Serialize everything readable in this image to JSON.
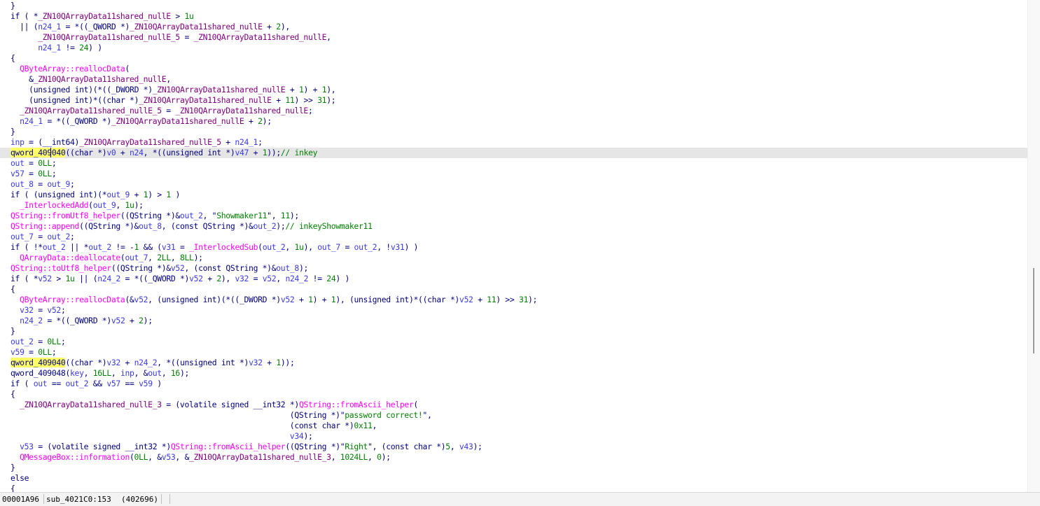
{
  "code_lines": [
    "}",
    "if ( *_ZN10QArrayData11shared_nullE > 1u",
    "  || (n24_1 = *((_QWORD *)_ZN10QArrayData11shared_nullE + 2),",
    "      _ZN10QArrayData11shared_nullE_5 = _ZN10QArrayData11shared_nullE,",
    "      n24_1 != 24) )",
    "{",
    "  QByteArray::reallocData(",
    "    &_ZN10QArrayData11shared_nullE,",
    "    (unsigned int)(*((_DWORD *)_ZN10QArrayData11shared_nullE + 1) + 1),",
    "    (unsigned int)*((char *)_ZN10QArrayData11shared_nullE + 11) >> 31);",
    "  _ZN10QArrayData11shared_nullE_5 = _ZN10QArrayData11shared_nullE;",
    "  n24_1 = *((_QWORD *)_ZN10QArrayData11shared_nullE + 2);",
    "}",
    "inp = (__int64)_ZN10QArrayData11shared_nullE_5 + n24_1;",
    "qword_409040((char *)v0 + n24, *((unsigned int *)v47 + 1));// inkey",
    "out = 0LL;",
    "v57 = 0LL;",
    "out_8 = out_9;",
    "if ( (unsigned int)(*out_9 + 1) > 1 )",
    "  _InterlockedAdd(out_9, 1u);",
    "QString::fromUtf8_helper((QString *)&out_2, \"Showmaker11\", 11);",
    "QString::append((QString *)&out_8, (const QString *)&out_2);// inkeyShowmaker11",
    "out_7 = out_2;",
    "if ( !*out_2 || *out_2 != -1 && (v31 = _InterlockedSub(out_2, 1u), out_7 = out_2, !v31) )",
    "  QArrayData::deallocate(out_7, 2LL, 8LL);",
    "QString::toUtf8_helper((QString *)&v52, (const QString *)&out_8);",
    "if ( *v52 > 1u || (n24_2 = *((_QWORD *)v52 + 2), v32 = v52, n24_2 != 24) )",
    "{",
    "  QByteArray::reallocData(&v52, (unsigned int)(*((_DWORD *)v52 + 1) + 1), (unsigned int)*((char *)v52 + 11) >> 31);",
    "  v32 = v52;",
    "  n24_2 = *((_QWORD *)v52 + 2);",
    "}",
    "out_2 = 0LL;",
    "v59 = 0LL;",
    "qword_409040((char *)v32 + n24_2, *((unsigned int *)v32 + 1));",
    "qword_409048(key, 16LL, inp, &out, 16);",
    "if ( out == out_2 && v57 == v59 )",
    "{",
    "  _ZN10QArrayData11shared_nullE_3 = (volatile signed __int32 *)QString::fromAscii_helper(",
    "                                                             (QString *)\"password correct!\",",
    "                                                             (const char *)0x11,",
    "                                                             v34);",
    "  v53 = (volatile signed __int32 *)QString::fromAscii_helper((QString *)\"Right\", (const char *)5, v43);",
    "  QMessageBox::information(0LL, &v53, &_ZN10QArrayData11shared_nullE_3, 1024LL, 0);",
    "}",
    "else",
    "{"
  ],
  "highlighted_line_index": 14,
  "highlight_word": "qword_409040",
  "status_bar": {
    "offset": "00001A96",
    "location": "sub_4021C0:153",
    "address": "(402696)"
  },
  "colors": {
    "keyword_text": "#000080",
    "variable": "#3a3ae0",
    "function": "#ff00ff",
    "number_string_comment": "#008000",
    "global": "#800080",
    "highlight_word_bg": "#ffff66",
    "current_line_bg": "#e6e6e6"
  }
}
